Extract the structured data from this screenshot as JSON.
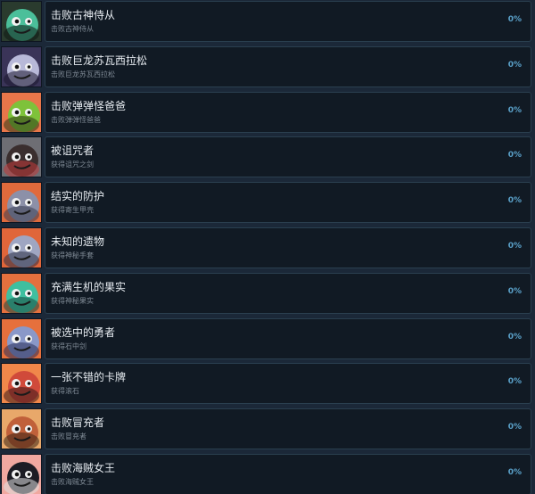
{
  "achievements": [
    {
      "title": "击败古神侍从",
      "desc": "击败古神侍从",
      "percent": "0%",
      "icon": "green-tentacle-monster-icon",
      "bg": "#2a3b2e",
      "fg": "#4bbf9a",
      "accent": "#0d1a14"
    },
    {
      "title": "击败巨龙苏瓦西拉松",
      "desc": "击败巨龙苏瓦西拉松",
      "percent": "0%",
      "icon": "dragon-icon",
      "bg": "#3a3458",
      "fg": "#b8b9d8",
      "accent": "#1c1830"
    },
    {
      "title": "击败弹弹怪爸爸",
      "desc": "击败弹弹怪爸爸",
      "percent": "0%",
      "icon": "green-slime-icon",
      "bg": "#e8764a",
      "fg": "#7ec23a",
      "accent": "#2e3a16"
    },
    {
      "title": "被诅咒者",
      "desc": "获得诅咒之剑",
      "percent": "0%",
      "icon": "cursed-warrior-icon",
      "bg": "#6e6e74",
      "fg": "#3a2e2e",
      "accent": "#c23a3a"
    },
    {
      "title": "结实的防护",
      "desc": "获得寄生甲壳",
      "percent": "0%",
      "icon": "shell-armor-icon",
      "bg": "#e06a3c",
      "fg": "#8c90a8",
      "accent": "#3a3e52"
    },
    {
      "title": "未知的遗物",
      "desc": "获得神秘手套",
      "percent": "0%",
      "icon": "mystery-glove-icon",
      "bg": "#e0663a",
      "fg": "#9fa6c2",
      "accent": "#2b2f45"
    },
    {
      "title": "充满生机的果实",
      "desc": "获得神秘果实",
      "percent": "0%",
      "icon": "mushroom-fruit-icon",
      "bg": "#e4703e",
      "fg": "#3fbf9f",
      "accent": "#1a4a40"
    },
    {
      "title": "被选中的勇者",
      "desc": "获得石中剑",
      "percent": "0%",
      "icon": "chosen-hero-icon",
      "bg": "#e6703c",
      "fg": "#8a98c8",
      "accent": "#2a2f5a"
    },
    {
      "title": "一张不错的卡牌",
      "desc": "获得滚石",
      "percent": "0%",
      "icon": "card-face-icon",
      "bg": "#f0874a",
      "fg": "#d04a3a",
      "accent": "#3a1a1a"
    },
    {
      "title": "击败冒充者",
      "desc": "击败冒充者",
      "percent": "0%",
      "icon": "impostor-icon",
      "bg": "#e8a86a",
      "fg": "#c0603a",
      "accent": "#3a2214"
    },
    {
      "title": "击败海贼女王",
      "desc": "击败海贼女王",
      "percent": "0%",
      "icon": "pirate-queen-icon",
      "bg": "#f0a8a0",
      "fg": "#1c1c24",
      "accent": "#e0e0e0"
    }
  ]
}
